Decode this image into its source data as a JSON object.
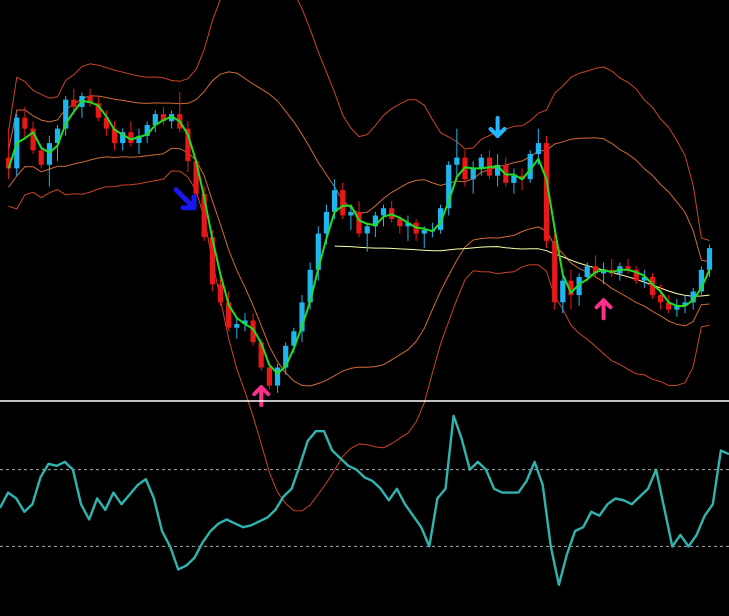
{
  "chart_data": [
    {
      "type": "candlestick",
      "panel": "price",
      "colors": {
        "background": "#000000",
        "bull_candle": "#1fb6f0",
        "bear_candle": "#e81818",
        "fast_ma": "#22dd22",
        "bands": "#c8442a",
        "inner_bands": "#d06a36",
        "long_ma": "#ffffaa",
        "buy_arrow": "#ff2e8c",
        "sell_arrow_dark": "#1818ee",
        "sell_arrow_light": "#22b8ff",
        "separator": "#ffffff"
      },
      "ylim": [
        0,
        100
      ],
      "candles": [
        {
          "o": 62,
          "h": 70,
          "l": 56,
          "c": 59
        },
        {
          "o": 59,
          "h": 74,
          "l": 57,
          "c": 73
        },
        {
          "o": 73,
          "h": 76,
          "l": 67,
          "c": 70
        },
        {
          "o": 70,
          "h": 72,
          "l": 63,
          "c": 64
        },
        {
          "o": 64,
          "h": 66,
          "l": 59,
          "c": 60
        },
        {
          "o": 60,
          "h": 68,
          "l": 54,
          "c": 66
        },
        {
          "o": 66,
          "h": 71,
          "l": 61,
          "c": 70
        },
        {
          "o": 70,
          "h": 79,
          "l": 68,
          "c": 78
        },
        {
          "o": 78,
          "h": 81,
          "l": 74,
          "c": 76
        },
        {
          "o": 76,
          "h": 80,
          "l": 73,
          "c": 79
        },
        {
          "o": 79,
          "h": 81,
          "l": 76,
          "c": 77
        },
        {
          "o": 77,
          "h": 79,
          "l": 72,
          "c": 73
        },
        {
          "o": 73,
          "h": 75,
          "l": 68,
          "c": 70
        },
        {
          "o": 70,
          "h": 72,
          "l": 64,
          "c": 66
        },
        {
          "o": 66,
          "h": 70,
          "l": 64,
          "c": 69
        },
        {
          "o": 69,
          "h": 72,
          "l": 65,
          "c": 66
        },
        {
          "o": 66,
          "h": 70,
          "l": 63,
          "c": 68
        },
        {
          "o": 68,
          "h": 72,
          "l": 66,
          "c": 71
        },
        {
          "o": 71,
          "h": 75,
          "l": 69,
          "c": 74
        },
        {
          "o": 74,
          "h": 76,
          "l": 71,
          "c": 72
        },
        {
          "o": 72,
          "h": 75,
          "l": 70,
          "c": 74
        },
        {
          "o": 74,
          "h": 80,
          "l": 69,
          "c": 70
        },
        {
          "o": 70,
          "h": 72,
          "l": 58,
          "c": 61
        },
        {
          "o": 61,
          "h": 62,
          "l": 50,
          "c": 52
        },
        {
          "o": 52,
          "h": 54,
          "l": 39,
          "c": 40
        },
        {
          "o": 40,
          "h": 42,
          "l": 25,
          "c": 27
        },
        {
          "o": 27,
          "h": 30,
          "l": 21,
          "c": 22
        },
        {
          "o": 22,
          "h": 25,
          "l": 14,
          "c": 15
        },
        {
          "o": 15,
          "h": 18,
          "l": 12,
          "c": 16
        },
        {
          "o": 16,
          "h": 19,
          "l": 14,
          "c": 17
        },
        {
          "o": 17,
          "h": 19,
          "l": 10,
          "c": 11
        },
        {
          "o": 11,
          "h": 12,
          "l": 3,
          "c": 4
        },
        {
          "o": 4,
          "h": 5,
          "l": -2,
          "c": -1
        },
        {
          "o": -1,
          "h": 5,
          "l": -3,
          "c": 4
        },
        {
          "o": 4,
          "h": 11,
          "l": 2,
          "c": 10
        },
        {
          "o": 10,
          "h": 15,
          "l": 8,
          "c": 14
        },
        {
          "o": 14,
          "h": 24,
          "l": 11,
          "c": 22
        },
        {
          "o": 22,
          "h": 33,
          "l": 20,
          "c": 31
        },
        {
          "o": 31,
          "h": 43,
          "l": 28,
          "c": 41
        },
        {
          "o": 41,
          "h": 49,
          "l": 38,
          "c": 47
        },
        {
          "o": 47,
          "h": 56,
          "l": 45,
          "c": 53
        },
        {
          "o": 53,
          "h": 55,
          "l": 45,
          "c": 46
        },
        {
          "o": 46,
          "h": 49,
          "l": 42,
          "c": 47
        },
        {
          "o": 47,
          "h": 50,
          "l": 40,
          "c": 41
        },
        {
          "o": 41,
          "h": 44,
          "l": 36,
          "c": 43
        },
        {
          "o": 43,
          "h": 47,
          "l": 40,
          "c": 46
        },
        {
          "o": 46,
          "h": 49,
          "l": 43,
          "c": 48
        },
        {
          "o": 48,
          "h": 50,
          "l": 44,
          "c": 45
        },
        {
          "o": 45,
          "h": 46,
          "l": 41,
          "c": 43
        },
        {
          "o": 43,
          "h": 46,
          "l": 39,
          "c": 44
        },
        {
          "o": 44,
          "h": 45,
          "l": 39,
          "c": 41
        },
        {
          "o": 41,
          "h": 43,
          "l": 37,
          "c": 42
        },
        {
          "o": 42,
          "h": 44,
          "l": 40,
          "c": 42
        },
        {
          "o": 42,
          "h": 49,
          "l": 41,
          "c": 48
        },
        {
          "o": 48,
          "h": 61,
          "l": 46,
          "c": 60
        },
        {
          "o": 60,
          "h": 70,
          "l": 56,
          "c": 62
        },
        {
          "o": 62,
          "h": 64,
          "l": 54,
          "c": 56
        },
        {
          "o": 56,
          "h": 61,
          "l": 52,
          "c": 59
        },
        {
          "o": 59,
          "h": 63,
          "l": 57,
          "c": 62
        },
        {
          "o": 62,
          "h": 64,
          "l": 56,
          "c": 57
        },
        {
          "o": 57,
          "h": 63,
          "l": 54,
          "c": 60
        },
        {
          "o": 60,
          "h": 62,
          "l": 54,
          "c": 55
        },
        {
          "o": 55,
          "h": 59,
          "l": 52,
          "c": 57
        },
        {
          "o": 57,
          "h": 59,
          "l": 53,
          "c": 56
        },
        {
          "o": 56,
          "h": 64,
          "l": 55,
          "c": 63
        },
        {
          "o": 63,
          "h": 70,
          "l": 60,
          "c": 66
        },
        {
          "o": 66,
          "h": 68,
          "l": 37,
          "c": 39
        },
        {
          "o": 39,
          "h": 41,
          "l": 20,
          "c": 22
        },
        {
          "o": 22,
          "h": 31,
          "l": 19,
          "c": 28
        },
        {
          "o": 28,
          "h": 31,
          "l": 20,
          "c": 24
        },
        {
          "o": 24,
          "h": 30,
          "l": 21,
          "c": 29
        },
        {
          "o": 29,
          "h": 33,
          "l": 28,
          "c": 32
        },
        {
          "o": 32,
          "h": 35,
          "l": 29,
          "c": 30
        },
        {
          "o": 30,
          "h": 33,
          "l": 27,
          "c": 31
        },
        {
          "o": 31,
          "h": 34,
          "l": 29,
          "c": 30
        },
        {
          "o": 30,
          "h": 33,
          "l": 28,
          "c": 32
        },
        {
          "o": 32,
          "h": 34,
          "l": 30,
          "c": 31
        },
        {
          "o": 31,
          "h": 32,
          "l": 27,
          "c": 28
        },
        {
          "o": 28,
          "h": 31,
          "l": 26,
          "c": 29
        },
        {
          "o": 29,
          "h": 30,
          "l": 23,
          "c": 24
        },
        {
          "o": 24,
          "h": 27,
          "l": 20,
          "c": 22
        },
        {
          "o": 22,
          "h": 24,
          "l": 19,
          "c": 20
        },
        {
          "o": 20,
          "h": 23,
          "l": 18,
          "c": 21
        },
        {
          "o": 21,
          "h": 24,
          "l": 19,
          "c": 22
        },
        {
          "o": 22,
          "h": 26,
          "l": 20,
          "c": 25
        },
        {
          "o": 25,
          "h": 32,
          "l": 24,
          "c": 31
        },
        {
          "o": 31,
          "h": 38,
          "l": 29,
          "c": 37
        }
      ],
      "markers": [
        {
          "type": "sell",
          "shade": "dark",
          "index": 23
        },
        {
          "type": "buy",
          "index": 31
        },
        {
          "type": "sell",
          "shade": "light",
          "index": 60
        },
        {
          "type": "buy",
          "index": 73
        }
      ]
    },
    {
      "type": "line",
      "panel": "oscillator",
      "ylim": [
        0,
        100
      ],
      "levels": [
        70,
        30
      ],
      "colors": {
        "line": "#30b4b0",
        "levels": "#a8a8a8"
      },
      "values": [
        50,
        58,
        55,
        48,
        52,
        66,
        73,
        72,
        74,
        70,
        52,
        44,
        55,
        49,
        58,
        52,
        57,
        62,
        65,
        55,
        38,
        30,
        18,
        20,
        24,
        32,
        38,
        42,
        44,
        42,
        40,
        41,
        43,
        45,
        49,
        56,
        60,
        72,
        85,
        90,
        90,
        80,
        76,
        72,
        70,
        66,
        64,
        60,
        54,
        60,
        52,
        46,
        40,
        30,
        55,
        60,
        98,
        86,
        70,
        74,
        70,
        60,
        58,
        58,
        58,
        64,
        74,
        62,
        30,
        10,
        26,
        38,
        40,
        48,
        46,
        52,
        55,
        54,
        52,
        56,
        60,
        70,
        50,
        30,
        36,
        30,
        36,
        46,
        52,
        80,
        78
      ]
    }
  ]
}
